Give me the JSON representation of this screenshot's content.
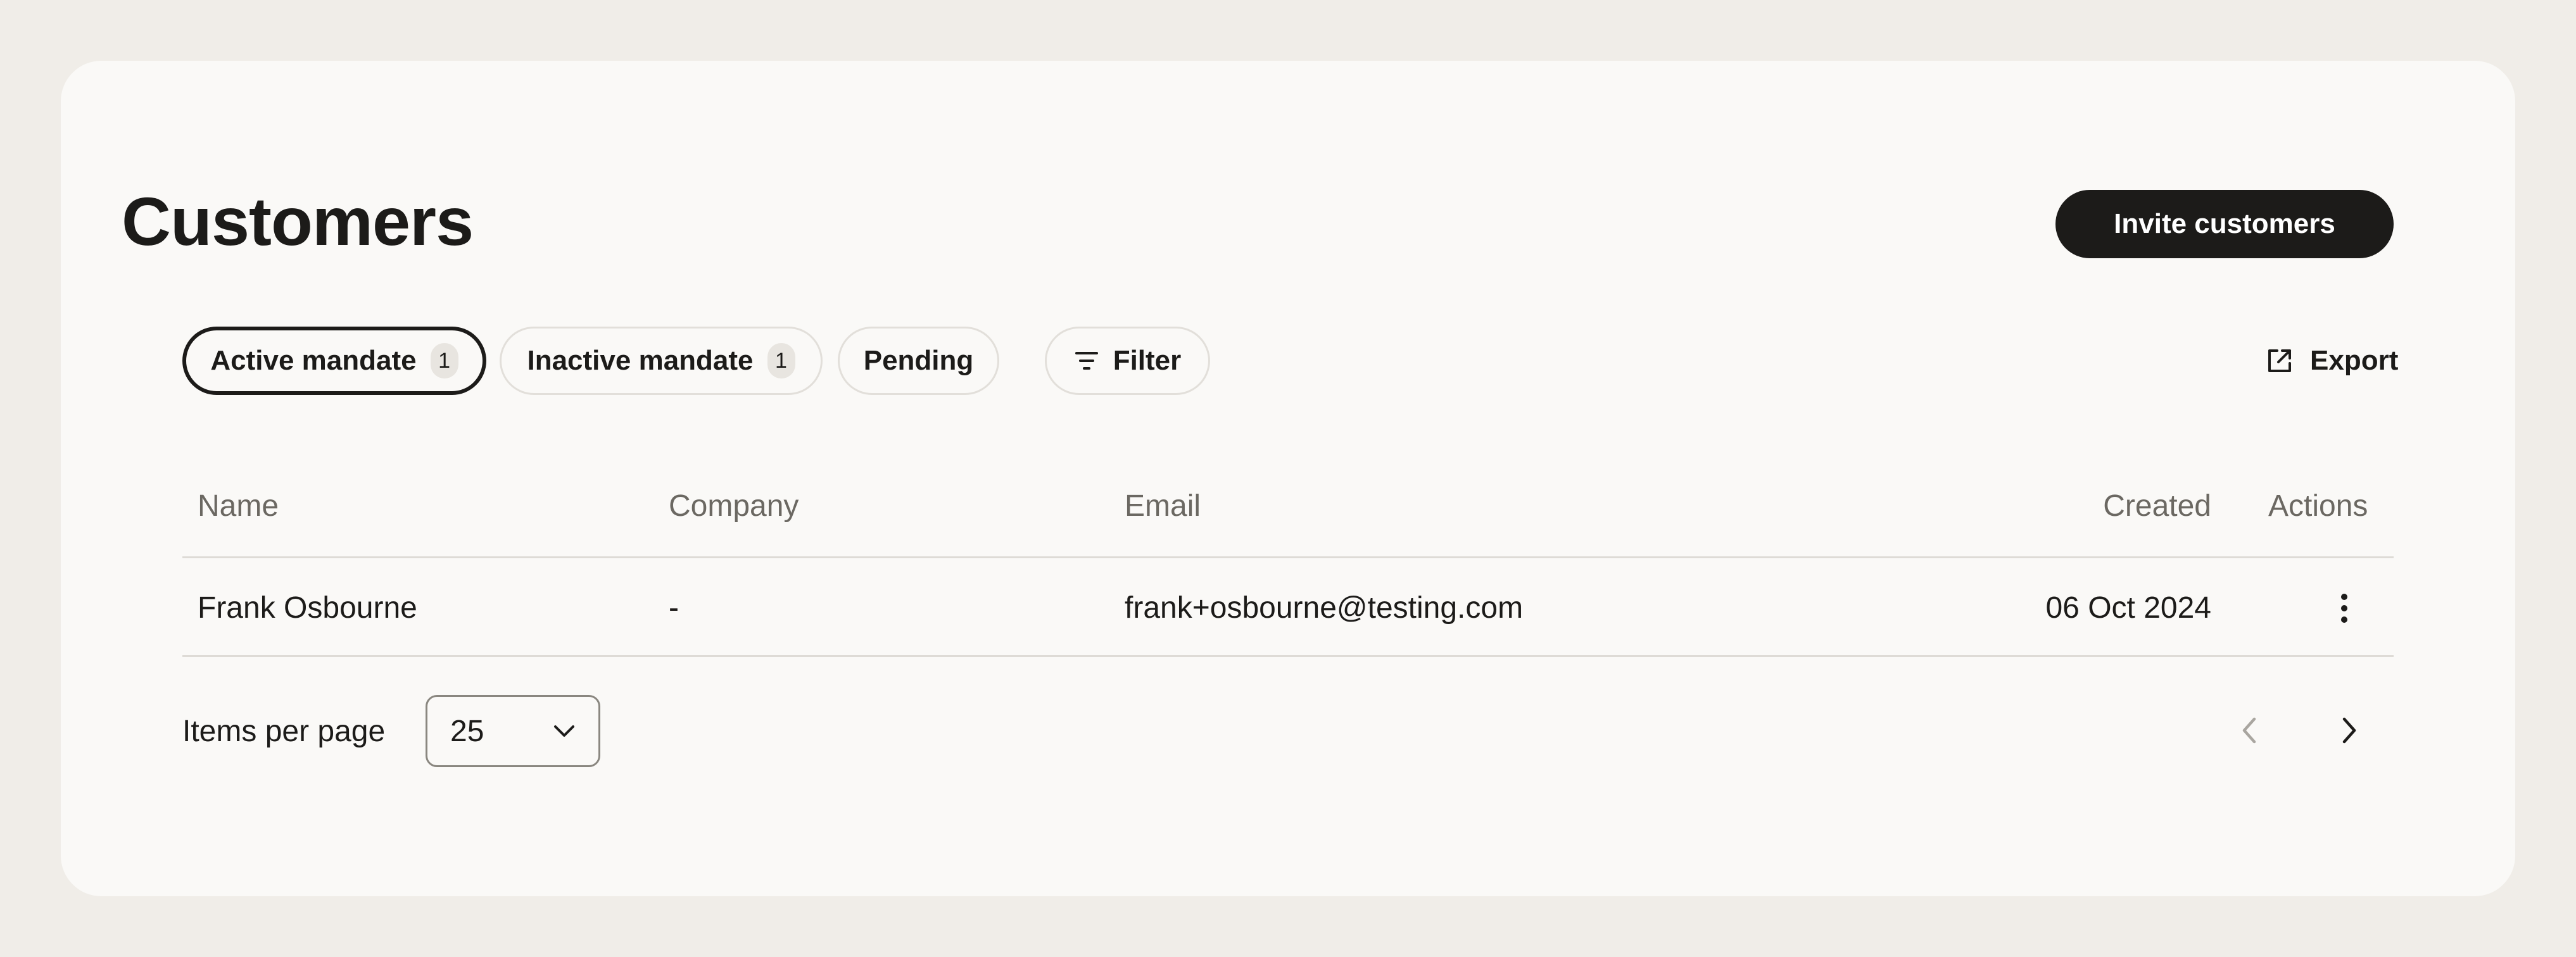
{
  "page": {
    "title": "Customers"
  },
  "header": {
    "invite_label": "Invite customers"
  },
  "filters": {
    "tabs": [
      {
        "label": "Active mandate",
        "count": "1",
        "active": true
      },
      {
        "label": "Inactive mandate",
        "count": "1",
        "active": false
      },
      {
        "label": "Pending",
        "count": null,
        "active": false
      }
    ],
    "filter_label": "Filter",
    "export_label": "Export"
  },
  "table": {
    "columns": [
      "Name",
      "Company",
      "Email",
      "Created",
      "Actions"
    ],
    "rows": [
      {
        "name": "Frank Osbourne",
        "company": "-",
        "email": "frank+osbourne@testing.com",
        "created": "06 Oct 2024"
      }
    ]
  },
  "pagination": {
    "items_per_page_label": "Items per page",
    "items_per_page_value": "25"
  },
  "icons": {
    "filter": "filter-icon",
    "export": "external-link-icon",
    "row_actions": "more-vertical-icon",
    "select": "chevron-down-icon",
    "prev": "chevron-left-icon",
    "next": "chevron-right-icon"
  },
  "colors": {
    "background": "#f0ede8",
    "card": "#faf9f7",
    "primary": "#1c1b19",
    "muted_text": "#6b6862",
    "border": "#dedbd6"
  }
}
